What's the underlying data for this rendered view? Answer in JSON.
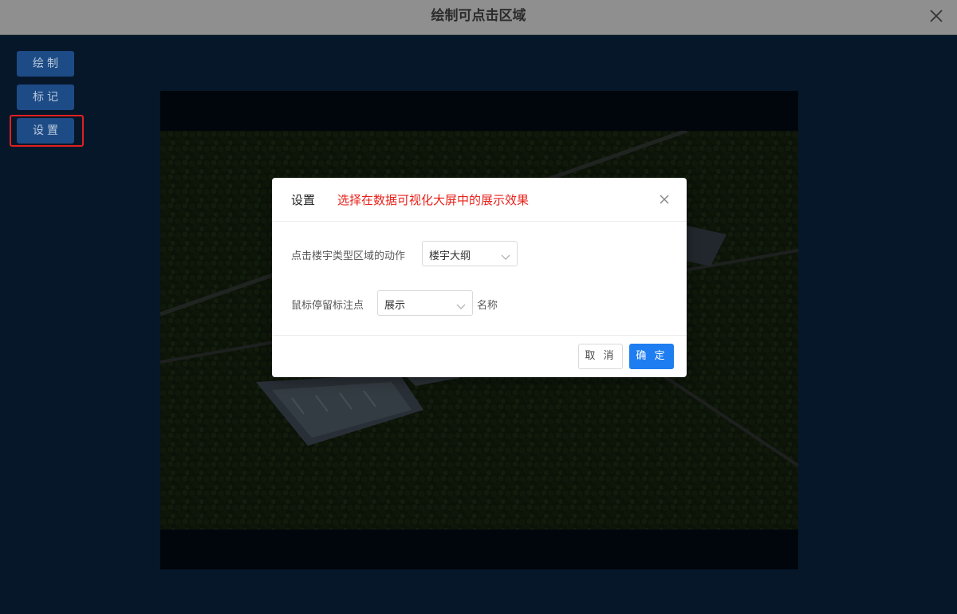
{
  "window": {
    "title": "绘制可点击区域",
    "close_icon": "close-icon"
  },
  "sidebar": {
    "items": [
      {
        "label": "绘制"
      },
      {
        "label": "标记"
      },
      {
        "label": "设置"
      }
    ]
  },
  "canvas": {
    "content": "aerial-factory-image"
  },
  "dialog": {
    "title": "设置",
    "note": "选择在数据可视化大屏中的展示效果",
    "fields": [
      {
        "label": "点击楼宇类型区域的动作",
        "value": "楼宇大纲"
      },
      {
        "label": "鼠标停留标注点",
        "value": "展示",
        "suffix": "名称"
      }
    ],
    "cancel_label": "取 消",
    "ok_label": "确 定"
  },
  "colors": {
    "accent": "#1e7df0",
    "note": "#e8211a",
    "sidebar_button": "#1d4b86",
    "highlight": "#e02020"
  }
}
